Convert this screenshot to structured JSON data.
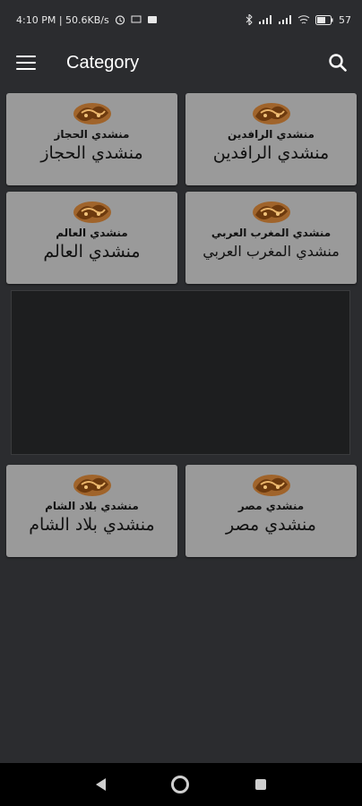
{
  "status": {
    "time": "4:10 PM | 50.6KB/s",
    "battery": "57"
  },
  "appbar": {
    "title": "Category"
  },
  "tiles": [
    {
      "small": "منشدي الرافدين",
      "big": "منشدي الرافدين"
    },
    {
      "small": "منشدي الحجاز",
      "big": "منشدي الحجاز"
    },
    {
      "small": "منشدي المغرب العربي",
      "big": "منشدي المغرب العربي"
    },
    {
      "small": "منشدي العالم",
      "big": "منشدي العالم"
    },
    {
      "small": "منشدي مصر",
      "big": "منشدي مصر"
    },
    {
      "small": "منشدي بلاد الشام",
      "big": "منشدي بلاد الشام"
    }
  ],
  "colors": {
    "background": "#2b2c2f",
    "tile": "#9a9a9a",
    "logo": "#8b4a14"
  }
}
